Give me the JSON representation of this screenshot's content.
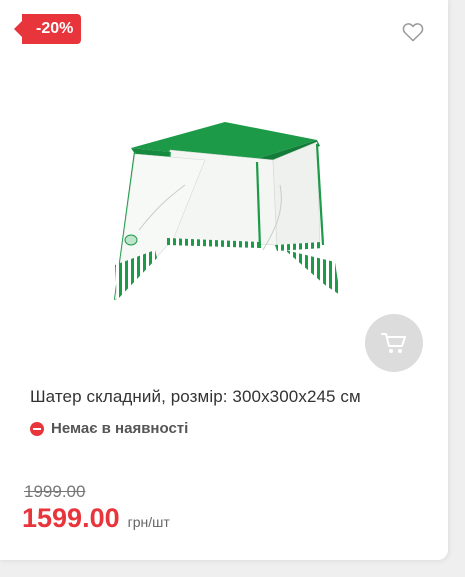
{
  "product": {
    "discount_badge": "-20%",
    "title": "Шатер складний, розмір: 300x300x245 см",
    "stock_status": "Немає в наявності",
    "old_price": "1999.00",
    "new_price": "1599.00",
    "unit": "грн/шт"
  },
  "icons": {
    "wishlist": "heart-icon",
    "cart": "cart-icon",
    "stock": "minus-circle-icon"
  },
  "colors": {
    "accent": "#e8353b",
    "tent_green": "#1c9a48",
    "cart_button_bg": "#dcdcdc"
  }
}
